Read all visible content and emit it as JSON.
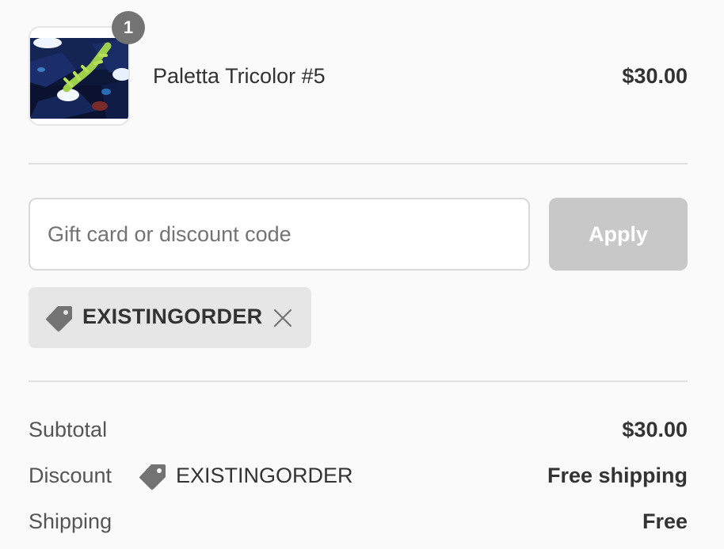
{
  "line_item": {
    "quantity": "1",
    "name": "Paletta Tricolor #5",
    "price": "$30.00"
  },
  "discount_form": {
    "placeholder": "Gift card or discount code",
    "value": "",
    "apply_label": "Apply"
  },
  "applied_code": {
    "code": "EXISTINGORDER",
    "icon": "tag-icon",
    "remove_icon": "close-icon"
  },
  "summary": {
    "subtotal_label": "Subtotal",
    "subtotal_value": "$30.00",
    "discount_label": "Discount",
    "discount_code": "EXISTINGORDER",
    "discount_value": "Free shipping",
    "shipping_label": "Shipping",
    "shipping_value": "Free"
  },
  "colors": {
    "background": "#fafafa",
    "badge": "#737373",
    "apply_button_disabled": "#c8c8c8",
    "tag_background": "#e6e6e6",
    "tag_icon": "#737373",
    "divider": "#e1e1e1"
  }
}
